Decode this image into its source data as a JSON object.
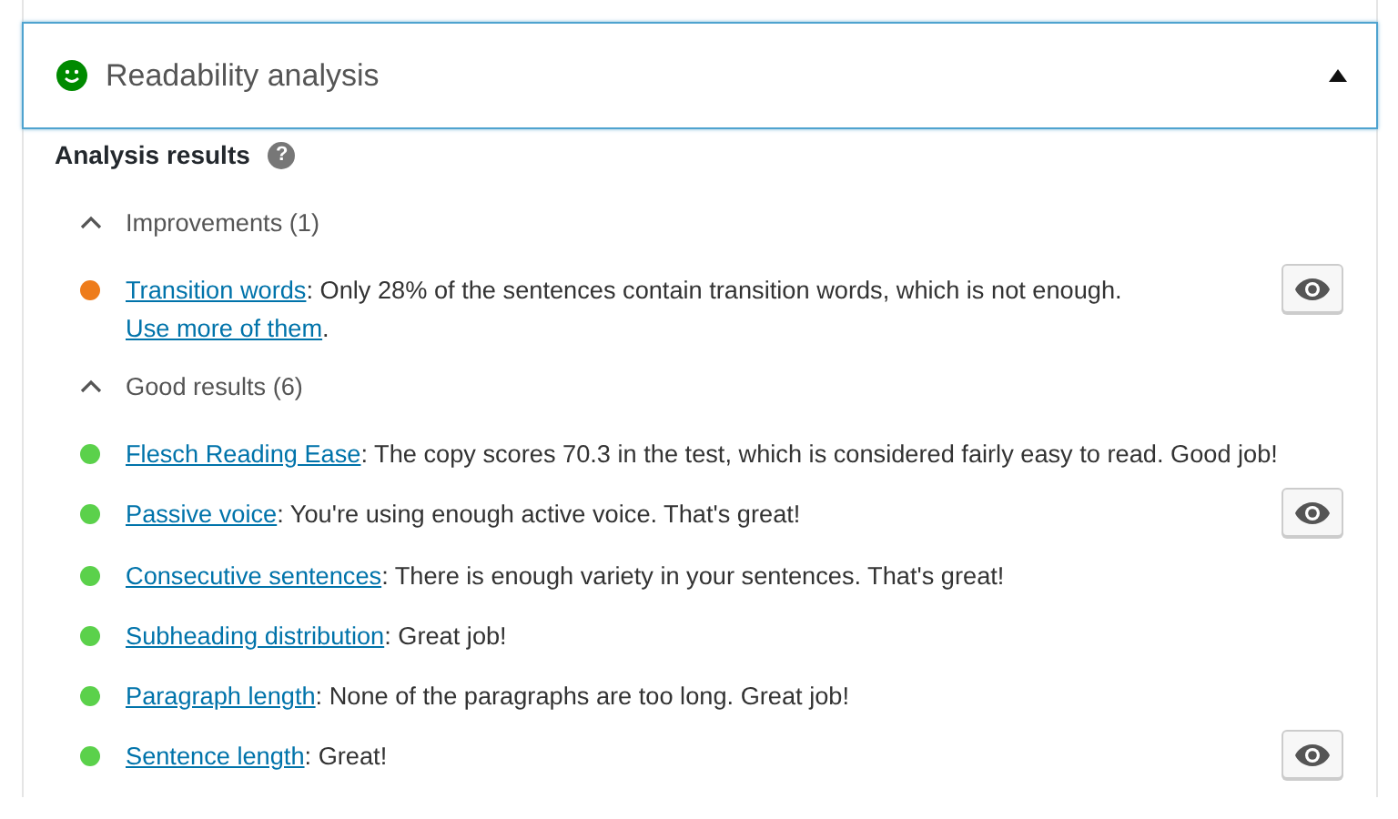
{
  "panel": {
    "title": "Readability analysis",
    "expanded": true,
    "heading": "Analysis results",
    "help": "?"
  },
  "groups": [
    {
      "title": "Improvements (1)",
      "expanded": true,
      "results": [
        {
          "color": "#ee7c1b",
          "eye_button": true,
          "parts": [
            {
              "kind": "link",
              "text": "Transition words"
            },
            {
              "kind": "text",
              "text": ": Only 28% of the sentences contain transition words, which is not enough. "
            },
            {
              "kind": "link",
              "text": "Use more of them"
            },
            {
              "kind": "text",
              "text": "."
            }
          ]
        }
      ]
    },
    {
      "title": "Good results (6)",
      "expanded": true,
      "results": [
        {
          "color": "#5bd14b",
          "eye_button": false,
          "parts": [
            {
              "kind": "link",
              "text": "Flesch Reading Ease"
            },
            {
              "kind": "text",
              "text": ": The copy scores 70.3 in the test, which is considered fairly easy to read. Good job!"
            }
          ]
        },
        {
          "color": "#5bd14b",
          "eye_button": true,
          "parts": [
            {
              "kind": "link",
              "text": "Passive voice"
            },
            {
              "kind": "text",
              "text": ": You're using enough active voice. That's great!"
            }
          ]
        },
        {
          "color": "#5bd14b",
          "eye_button": false,
          "parts": [
            {
              "kind": "link",
              "text": "Consecutive sentences"
            },
            {
              "kind": "text",
              "text": ": There is enough variety in your sentences. That's great!"
            }
          ]
        },
        {
          "color": "#5bd14b",
          "eye_button": false,
          "parts": [
            {
              "kind": "link",
              "text": "Subheading distribution"
            },
            {
              "kind": "text",
              "text": ": Great job!"
            }
          ]
        },
        {
          "color": "#5bd14b",
          "eye_button": false,
          "parts": [
            {
              "kind": "link",
              "text": "Paragraph length"
            },
            {
              "kind": "text",
              "text": ": None of the paragraphs are too long. Great job!"
            }
          ]
        },
        {
          "color": "#5bd14b",
          "eye_button": true,
          "parts": [
            {
              "kind": "link",
              "text": "Sentence length"
            },
            {
              "kind": "text",
              "text": ": Great!"
            }
          ]
        }
      ]
    }
  ]
}
